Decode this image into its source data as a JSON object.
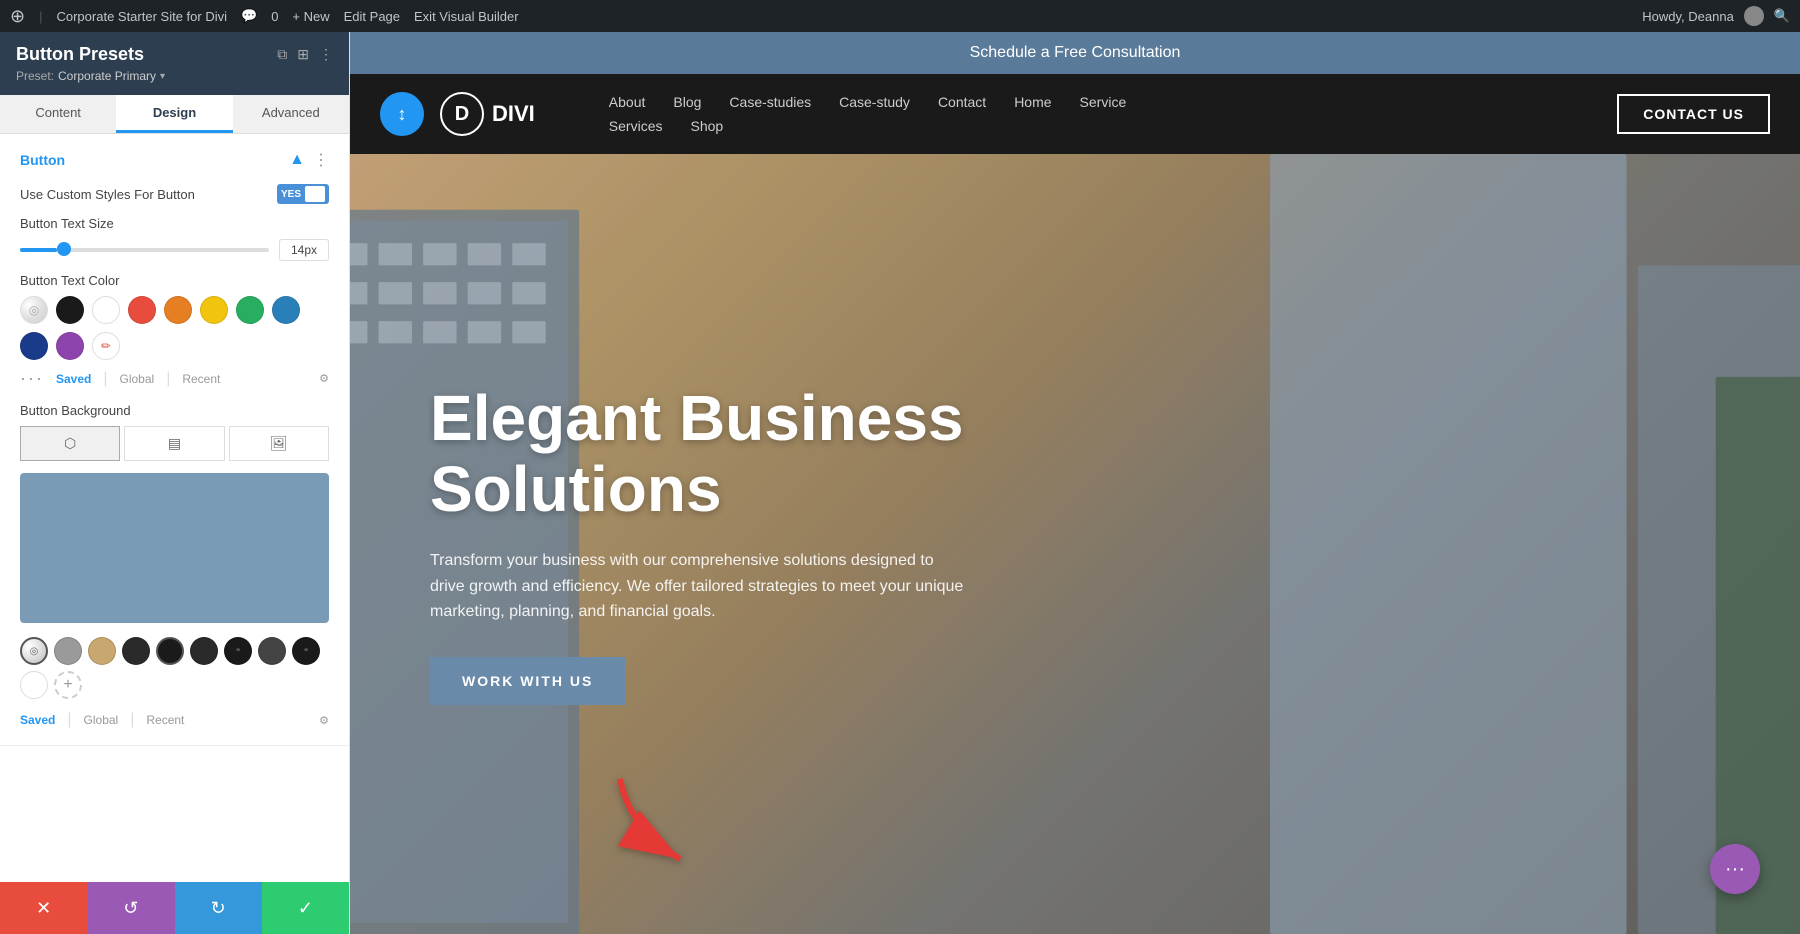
{
  "admin_bar": {
    "site_name": "Corporate Starter Site for Divi",
    "comments": "0",
    "new_label": "+ New",
    "edit_page": "Edit Page",
    "exit_builder": "Exit Visual Builder",
    "howdy": "Howdy, Deanna",
    "wp_icon": "W"
  },
  "panel": {
    "title": "Button Presets",
    "preset_label": "Preset:",
    "preset_name": "Corporate Primary",
    "tabs": [
      {
        "id": "content",
        "label": "Content"
      },
      {
        "id": "design",
        "label": "Design"
      },
      {
        "id": "advanced",
        "label": "Advanced"
      }
    ],
    "active_tab": "design",
    "section_button": {
      "title": "Button",
      "toggle_label": "Use Custom Styles For Button",
      "toggle_state": "YES",
      "size_label": "Button Text Size",
      "size_value": "14px",
      "color_label": "Button Text Color",
      "swatches": [
        {
          "name": "eyedropper",
          "color": "transparent",
          "type": "eyedropper"
        },
        {
          "name": "black",
          "color": "#1a1a1a"
        },
        {
          "name": "white",
          "color": "#ffffff"
        },
        {
          "name": "red",
          "color": "#e74c3c"
        },
        {
          "name": "orange",
          "color": "#e67e22"
        },
        {
          "name": "yellow",
          "color": "#f1c40f"
        },
        {
          "name": "green",
          "color": "#27ae60"
        },
        {
          "name": "blue",
          "color": "#2980b9"
        },
        {
          "name": "dark-blue",
          "color": "#1a3a8a"
        },
        {
          "name": "purple",
          "color": "#8e44ad"
        },
        {
          "name": "pencil",
          "color": "transparent",
          "type": "pencil"
        }
      ],
      "color_tabs": [
        "Saved",
        "Global",
        "Recent"
      ],
      "active_color_tab": "Saved",
      "bg_label": "Button Background",
      "bg_types": [
        {
          "id": "color",
          "icon": "⬤"
        },
        {
          "id": "gradient",
          "icon": "▤"
        },
        {
          "id": "image",
          "icon": "🖼"
        }
      ],
      "bottom_swatches": [
        {
          "name": "eyedropper-small",
          "color": "transparent",
          "type": "eyedropper"
        },
        {
          "name": "gray",
          "color": "#9a9a9a"
        },
        {
          "name": "tan",
          "color": "#c8a870"
        },
        {
          "name": "dark-1",
          "color": "#2a2a2a"
        },
        {
          "name": "dark-2",
          "color": "#1a1a1a"
        },
        {
          "name": "dark-3",
          "color": "#333333"
        },
        {
          "name": "quote-1",
          "color": "#2a2a2a"
        },
        {
          "name": "dark-4",
          "color": "#444444"
        },
        {
          "name": "quote-2",
          "color": "#1a1a1a"
        },
        {
          "name": "white-round",
          "color": "#ffffff"
        }
      ]
    }
  },
  "footer_buttons": {
    "cancel": "✕",
    "undo": "↺",
    "redo": "↻",
    "save": "✓"
  },
  "site": {
    "schedule_bar": "Schedule a Free Consultation",
    "logo_letter": "D",
    "logo_text": "DIVI",
    "nav_top": [
      "About",
      "Blog",
      "Case-studies",
      "Case-study",
      "Contact",
      "Home",
      "Service"
    ],
    "nav_bottom": [
      "Services",
      "Shop"
    ],
    "contact_btn": "CONTACT US"
  },
  "hero": {
    "title": "Elegant Business Solutions",
    "subtitle": "Transform your business with our comprehensive solutions designed to drive growth and efficiency. We offer tailored strategies to meet your unique marketing, planning, and financial goals.",
    "cta": "WORK WITH US"
  }
}
